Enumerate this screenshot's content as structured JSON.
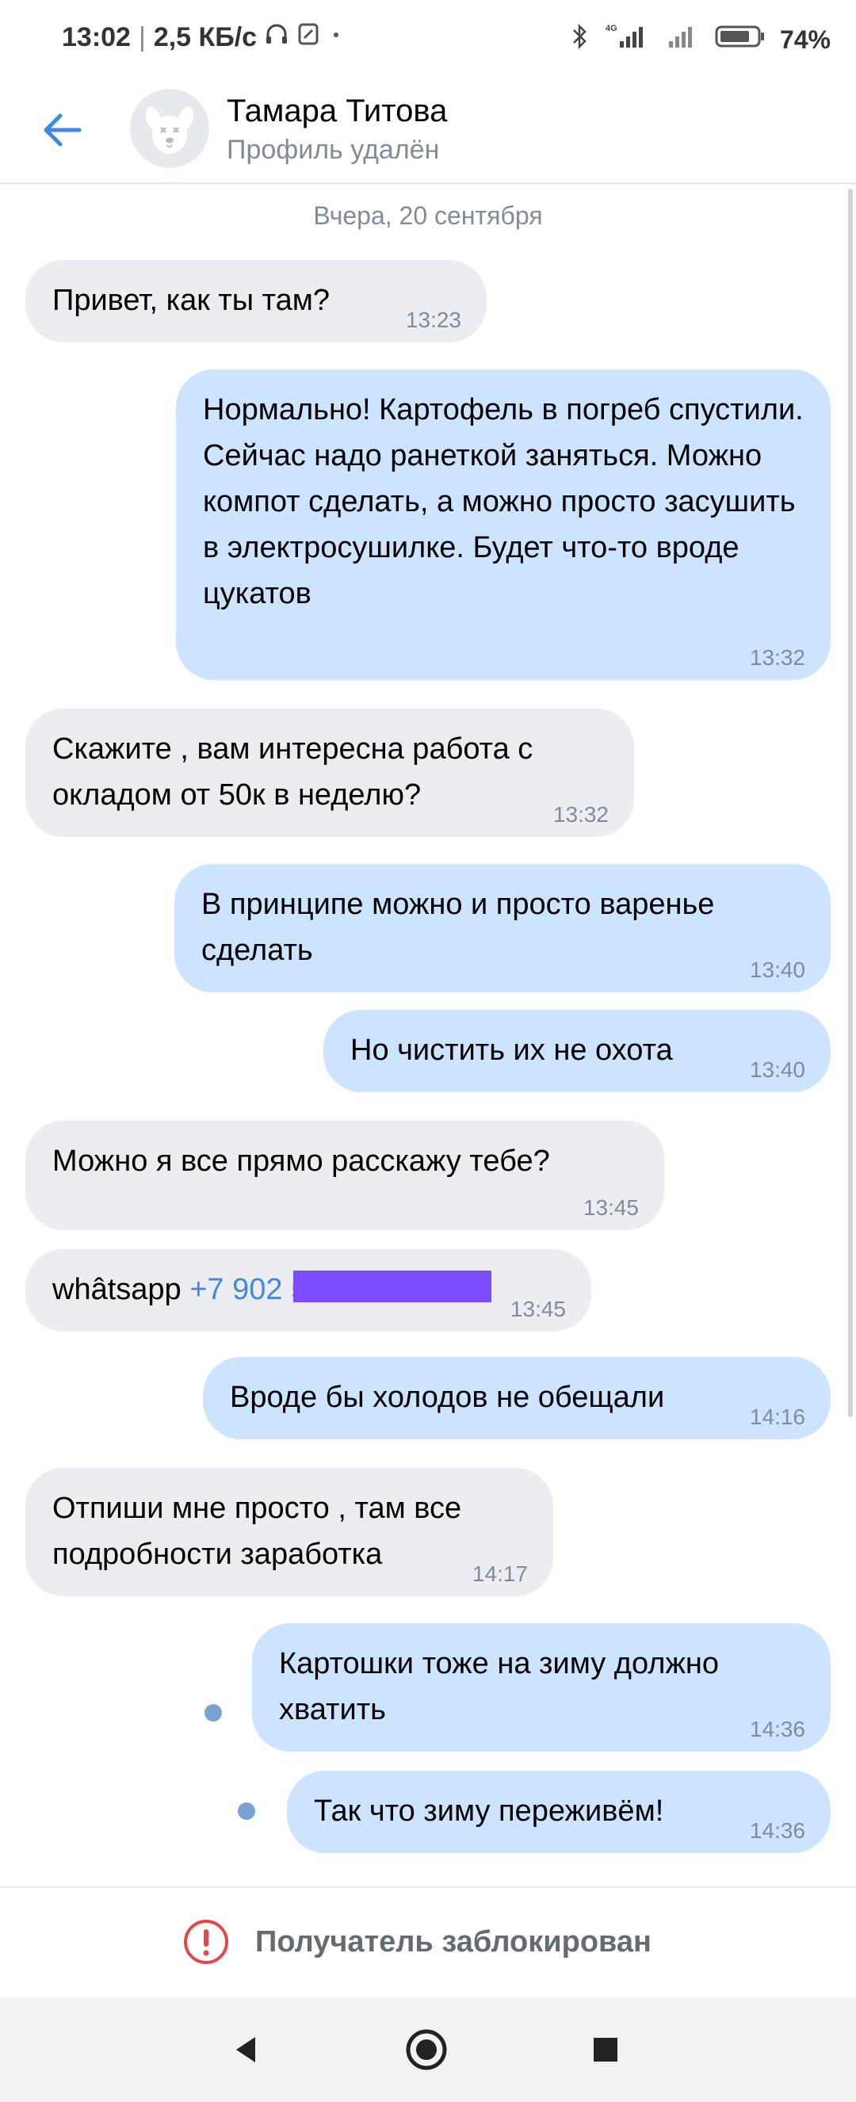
{
  "status_bar": {
    "time": "13:02",
    "speed": "2,5 КБ/с",
    "network_label": "4G",
    "battery": "74%",
    "icons": [
      "headphones-icon",
      "sim-card-icon",
      "dot-icon",
      "bluetooth-icon",
      "signal-icon",
      "battery-icon"
    ]
  },
  "header": {
    "name": "Тамара Титова",
    "status": "Профиль удалён"
  },
  "chat": {
    "date_separator": "Вчера, 20 сентября",
    "messages": [
      {
        "dir": "in",
        "text": "Привет, как ты там?",
        "time": "13:23"
      },
      {
        "dir": "out",
        "text": "Нормально! Картофель в погреб спустили. Сейчас надо ранеткой заняться. Можно компот сделать, а можно просто засушить в электросушилке. Будет что-то вроде цукатов",
        "time": "13:32"
      },
      {
        "dir": "in",
        "text": "Скажите , вам интересна работа с окладом от 50к в неделю?",
        "time": "13:32"
      },
      {
        "dir": "out",
        "text": "В принципе можно и просто варенье сделать",
        "time": "13:40"
      },
      {
        "dir": "out",
        "text": "Но чистить их не охота",
        "time": "13:40"
      },
      {
        "dir": "in",
        "text": "Можно я все прямо расскажу тебе?",
        "time": "13:45"
      },
      {
        "dir": "in",
        "text": "whâtsapp",
        "link": "+7 902 5",
        "time": "13:45"
      },
      {
        "dir": "out",
        "text": "Вроде бы холодов не обещали",
        "time": "14:16"
      },
      {
        "dir": "in",
        "text": "Отпиши мне просто , там все подробности заработка",
        "time": "14:17"
      },
      {
        "dir": "out",
        "text": "Картошки тоже на зиму должно хватить",
        "time": "14:36",
        "unread": true
      },
      {
        "dir": "out",
        "text": "Так что зиму переживём!",
        "time": "14:36",
        "unread": true
      }
    ]
  },
  "footer": {
    "blocked_text": "Получатель заблокирован"
  },
  "colors": {
    "accent": "#3f8ae0",
    "incoming_bubble": "#ebedf0",
    "outgoing_bubble": "#cce4ff",
    "error": "#e64646",
    "redaction": "#7b4dff"
  }
}
